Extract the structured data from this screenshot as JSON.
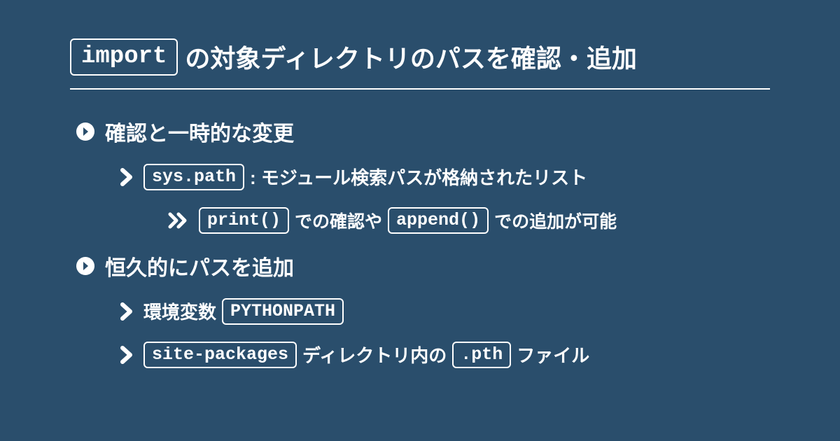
{
  "title": {
    "code": "import",
    "text": "の対象ディレクトリのパスを確認・追加"
  },
  "sections": [
    {
      "heading": "確認と一時的な変更",
      "items": [
        {
          "code1": "sys.path",
          "text1": ": モジュール検索パスが格納されたリスト",
          "subitems": [
            {
              "code1": "print()",
              "text1": "での確認や",
              "code2": "append()",
              "text2": "での追加が可能"
            }
          ]
        }
      ]
    },
    {
      "heading": "恒久的にパスを追加",
      "items": [
        {
          "text1": "環境変数",
          "code1": "PYTHONPATH"
        },
        {
          "code1": "site-packages",
          "text1": "ディレクトリ内の",
          "code2": ".pth",
          "text2": "ファイル"
        }
      ]
    }
  ]
}
